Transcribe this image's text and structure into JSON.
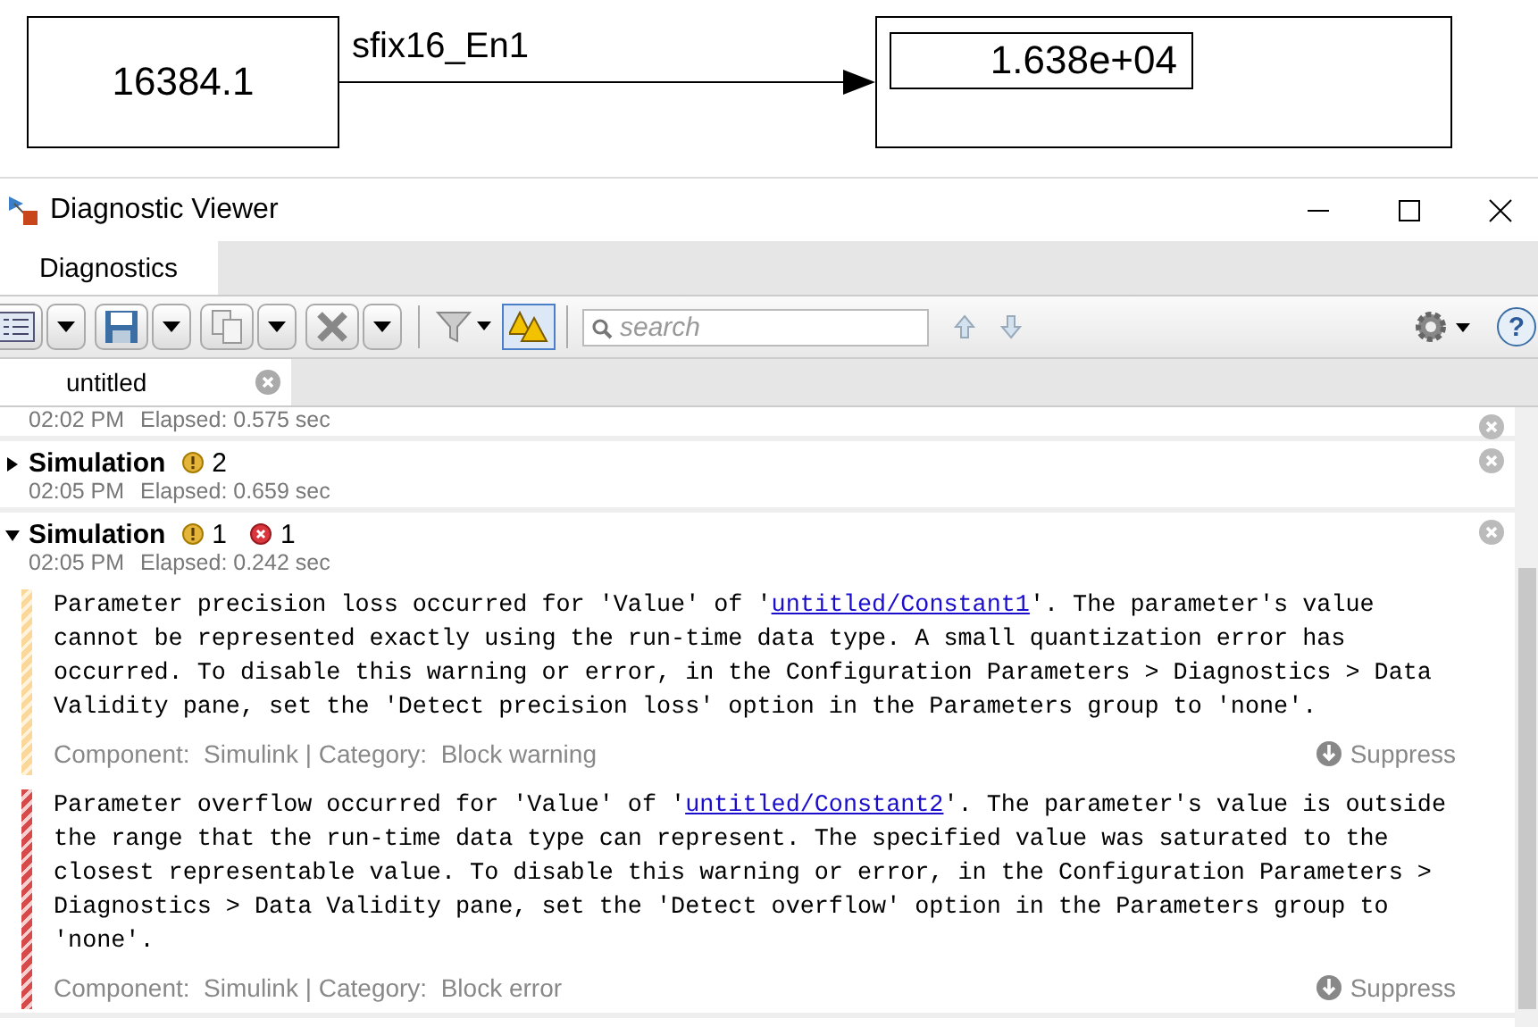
{
  "diagram": {
    "source_block": "16384.1",
    "signal_label": "sfix16_En1",
    "display_block": "1.638e+04"
  },
  "window": {
    "title": "Diagnostic Viewer"
  },
  "tabs": [
    {
      "label": "Diagnostics",
      "selected": true
    }
  ],
  "toolbar": {
    "search_placeholder": "search",
    "warnings_toggle_on": true,
    "help_label": "?"
  },
  "documents": [
    {
      "label": "untitled",
      "selected": true
    }
  ],
  "runs": [
    {
      "time": "02:02 PM",
      "elapsed": "Elapsed: 0.575 sec"
    },
    {
      "title": "Simulation",
      "warnings": "2",
      "time": "02:05 PM",
      "elapsed": "Elapsed: 0.659 sec",
      "expanded": false
    },
    {
      "title": "Simulation",
      "warnings": "1",
      "errors": "1",
      "time": "02:05 PM",
      "elapsed": "Elapsed: 0.242 sec",
      "expanded": true,
      "messages": [
        {
          "kind": "warning",
          "before": "Parameter precision loss occurred for 'Value' of '",
          "link": "untitled/Constant1",
          "after": "'. The parameter's value cannot be represented exactly using the run-time data type. A small quantization error has occurred. To disable this warning or error, in the Configuration Parameters > Diagnostics > Data Validity pane, set the 'Detect precision loss' option in the Parameters group to 'none'.",
          "component": "Component:  Simulink | Category:  Block warning",
          "action": "Suppress"
        },
        {
          "kind": "error",
          "before": "Parameter overflow occurred for 'Value' of '",
          "link": "untitled/Constant2",
          "after": "'. The parameter's value is outside the range that the run-time data type can represent. The specified value was saturated to the closest representable value. To disable this warning or error, in the Configuration Parameters > Diagnostics > Data Validity pane, set the 'Detect overflow' option in the Parameters group to 'none'.",
          "component": "Component:  Simulink | Category:  Block error",
          "action": "Suppress"
        }
      ]
    }
  ]
}
